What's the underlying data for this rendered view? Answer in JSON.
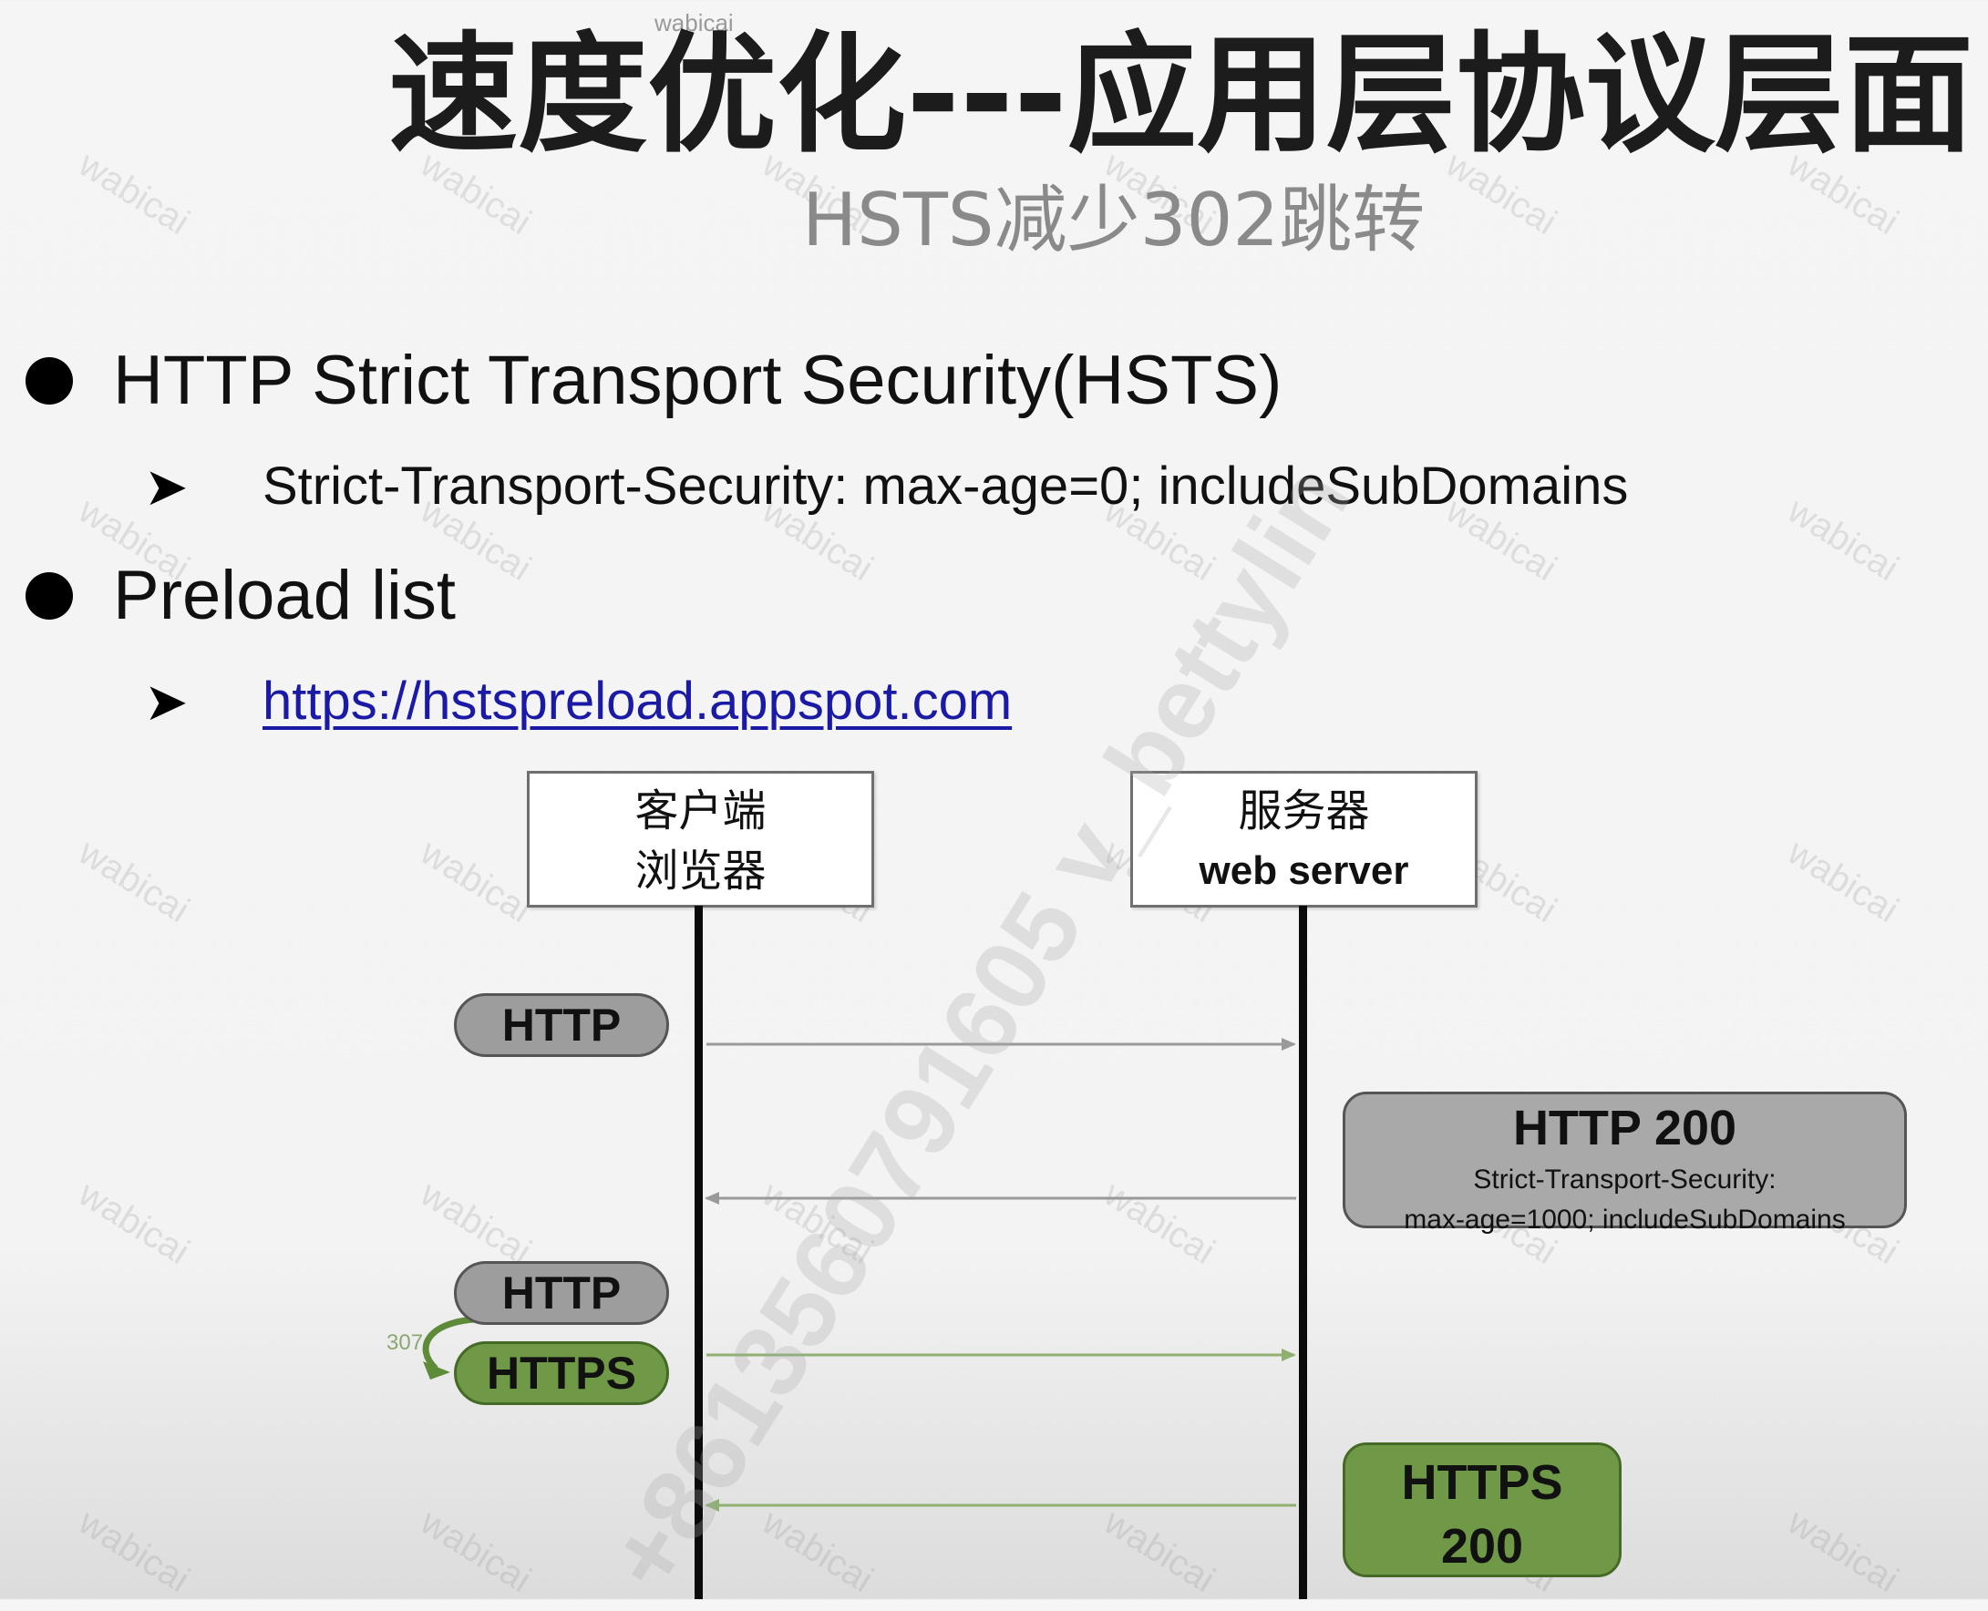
{
  "slide": {
    "top_mark": "wabicai",
    "title": "速度优化---应用层协议层面",
    "subtitle": "HSTS减少302跳转",
    "bullets": [
      {
        "text": "HTTP Strict Transport Security(HSTS)",
        "sub": "Strict-Transport-Security: max-age=0; includeSubDomains"
      },
      {
        "text": "Preload list",
        "sub_link": "https://hstspreload.appspot.com"
      }
    ]
  },
  "diagram": {
    "client_box": {
      "line1": "客户端",
      "line2": "浏览器"
    },
    "server_box": {
      "line1": "服务器",
      "line2": "web server"
    },
    "requests": [
      {
        "label": "HTTP",
        "style": "gray"
      },
      {
        "label": "HTTP",
        "style": "gray"
      },
      {
        "label": "HTTPS",
        "style": "green"
      }
    ],
    "redirect_label": "307",
    "responses": [
      {
        "title": "HTTP  200",
        "line2": "Strict-Transport-Security:",
        "line3": "max-age=1000; includeSubDomains",
        "style": "gray"
      },
      {
        "title": "HTTPS",
        "line2": "200",
        "style": "green"
      }
    ],
    "colors": {
      "request_gray": "#9d9d9d",
      "https_green": "#6f9946",
      "message_line_gray": "#9a9a9a",
      "message_line_green": "#8fb070"
    }
  },
  "watermark": {
    "tile_text": "wabicai",
    "diagonal_text": "+8613560791605 v_bettylin"
  }
}
